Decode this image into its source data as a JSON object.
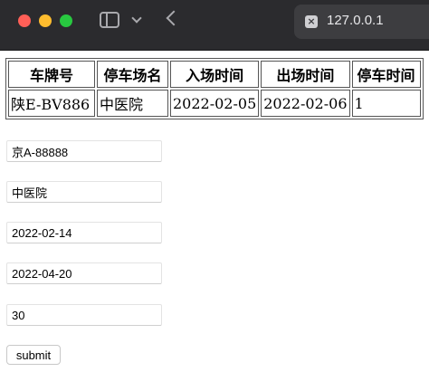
{
  "browser": {
    "tab_title": "127.0.0.1",
    "tab_close_glyph": "×"
  },
  "table": {
    "headers": [
      "车牌号",
      "停车场名",
      "入场时间",
      "出场时间",
      "停车时间"
    ],
    "rows": [
      [
        "陕E-BV886",
        "中医院",
        "2022-02-05",
        "2022-02-06",
        "1"
      ]
    ]
  },
  "form": {
    "plate": "京A-88888",
    "parking_lot": "中医院",
    "entry_time": "2022-02-14",
    "exit_time": "2022-04-20",
    "duration": "30",
    "submit_label": "submit"
  },
  "icons": {
    "close": "close-icon",
    "sidebar": "sidebar-icon",
    "chevron": "chevron-down-icon",
    "back": "back-arrow-icon"
  },
  "colors": {
    "chrome_bg": "#2b2b2e",
    "close_dot": "#ff5f57",
    "minimize_dot": "#febc2e",
    "zoom_dot": "#28c840"
  }
}
